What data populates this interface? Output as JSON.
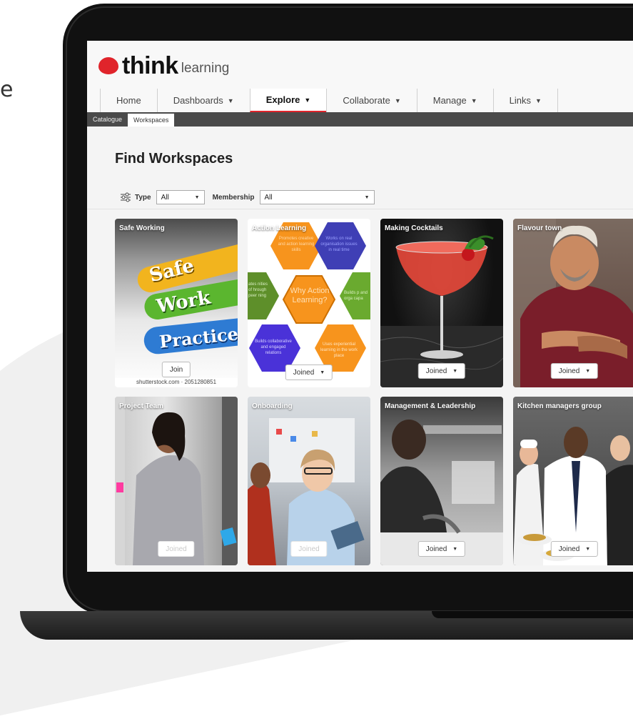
{
  "backdrop": {
    "cut_text": "e"
  },
  "logo": {
    "brand": "think",
    "product": "learning",
    "accent_color": "#e0242b"
  },
  "nav": [
    {
      "label": "Home",
      "dropdown": false,
      "active": false
    },
    {
      "label": "Dashboards",
      "dropdown": true,
      "active": false
    },
    {
      "label": "Explore",
      "dropdown": true,
      "active": true
    },
    {
      "label": "Collaborate",
      "dropdown": true,
      "active": false
    },
    {
      "label": "Manage",
      "dropdown": true,
      "active": false
    },
    {
      "label": "Links",
      "dropdown": true,
      "active": false
    }
  ],
  "subnav": [
    {
      "label": "Catalogue",
      "active": false
    },
    {
      "label": "Workspaces",
      "active": true
    }
  ],
  "page": {
    "title": "Find Workspaces"
  },
  "filters": {
    "type_label": "Type",
    "type_value": "All",
    "membership_label": "Membership",
    "membership_value": "All"
  },
  "workspaces": [
    {
      "title": "Safe Working",
      "button": "Join",
      "button_state": "join",
      "image_text": {
        "line1": "Safe",
        "line2": "Work",
        "line3": "Practice",
        "credit": "shutterstock.com · 2051280851"
      }
    },
    {
      "title": "Action Learning",
      "button": "Joined",
      "button_state": "joined",
      "hexagons": {
        "center": "Why Action Learning?",
        "top": "Works on real organisation issues in real time",
        "right": "Builds p and orga capa",
        "bottom_right": "Uses experiential learning in the work place",
        "bottom_left": "Builds collaborative and engaged relations",
        "left": "ates nities of hrough peer ning",
        "top_left": "Promotes creative and action learning skills"
      }
    },
    {
      "title": "Making Cocktails",
      "button": "Joined",
      "button_state": "joined"
    },
    {
      "title": "Flavour town",
      "button": "Joined",
      "button_state": "joined"
    },
    {
      "title": "Project Team",
      "button": "Joined",
      "button_state": "disabled"
    },
    {
      "title": "Onboarding",
      "button": "Joined",
      "button_state": "disabled"
    },
    {
      "title": "Management & Leadership",
      "button": "Joined",
      "button_state": "joined"
    },
    {
      "title": "Kitchen managers group",
      "button": "Joined",
      "button_state": "joined"
    }
  ]
}
